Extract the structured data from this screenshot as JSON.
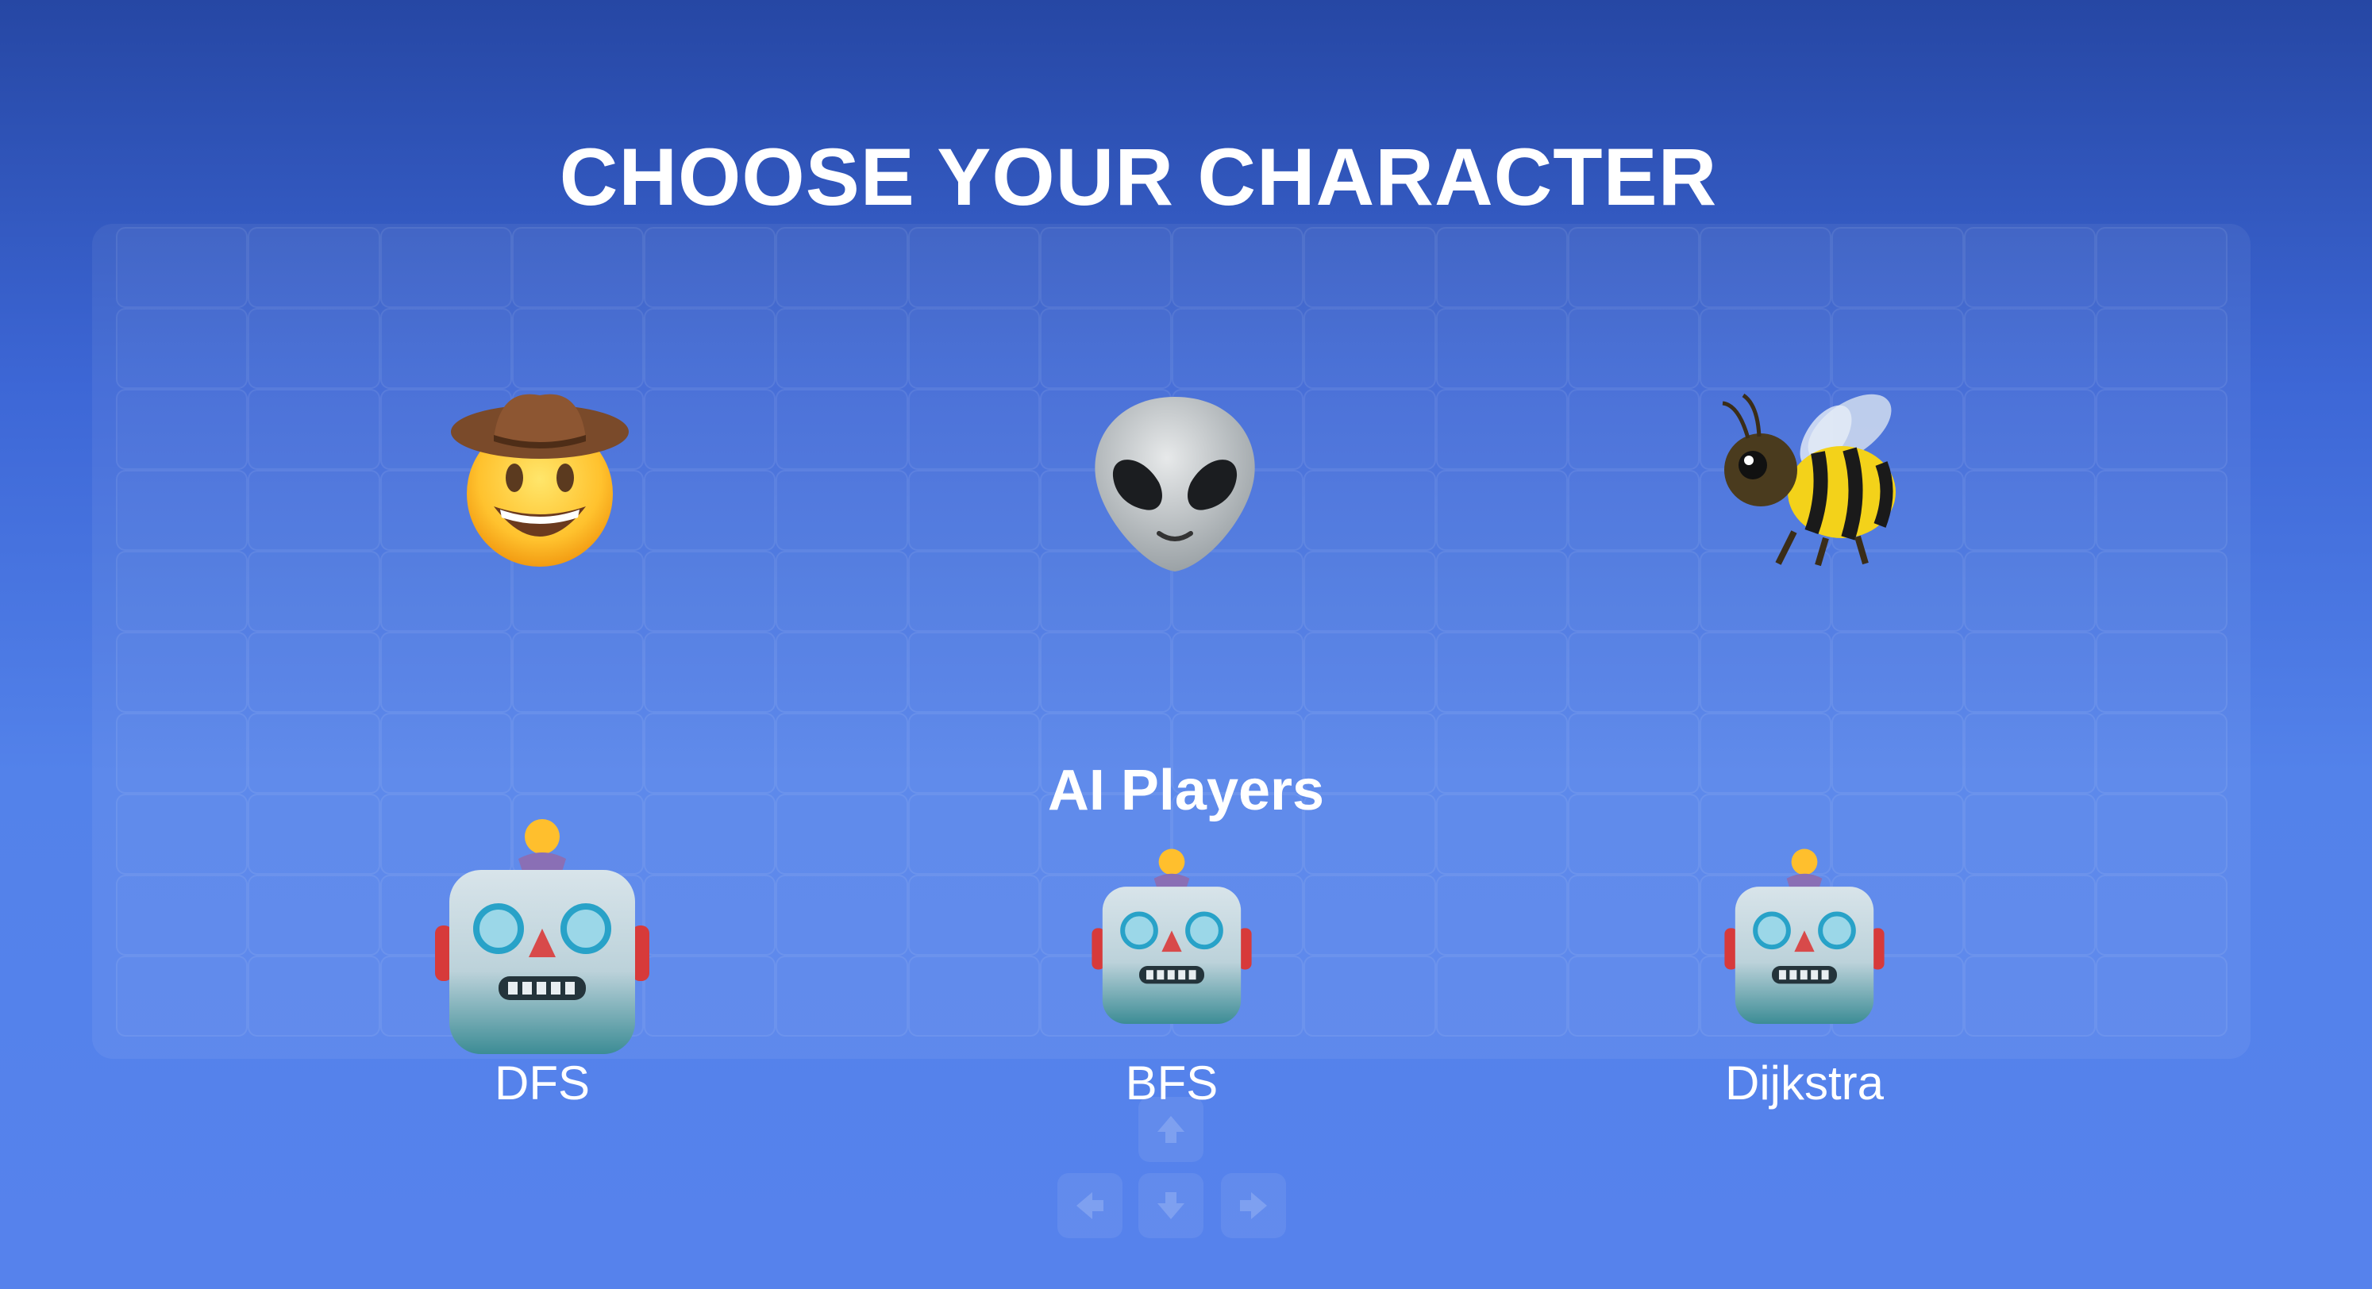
{
  "title": "CHOOSE YOUR CHARACTER",
  "characters": [
    {
      "name": "cowboy",
      "icon": "cowboy-hat-face-icon"
    },
    {
      "name": "alien",
      "icon": "alien-icon"
    },
    {
      "name": "bee",
      "icon": "honeybee-icon"
    }
  ],
  "ai_section": {
    "heading": "AI Players",
    "players": [
      {
        "label": "DFS",
        "icon": "robot-icon"
      },
      {
        "label": "BFS",
        "icon": "robot-icon"
      },
      {
        "label": "Dijkstra",
        "icon": "robot-icon"
      }
    ]
  },
  "controls": {
    "icons": [
      "arrow-up-icon",
      "arrow-left-icon",
      "arrow-down-icon",
      "arrow-right-icon"
    ]
  },
  "colors": {
    "background_top": "#2647a4",
    "background_bottom": "#5682ec",
    "text": "#ffffff"
  }
}
